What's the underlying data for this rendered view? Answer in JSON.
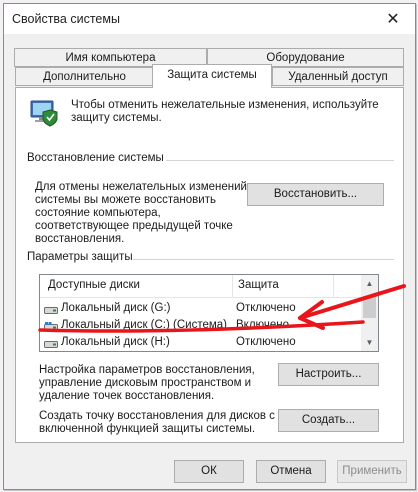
{
  "window": {
    "title": "Свойства системы",
    "close_glyph": "✕"
  },
  "tabs": {
    "row1": [
      "Имя компьютера",
      "Оборудование"
    ],
    "row2": [
      "Дополнительно",
      "Защита системы",
      "Удаленный доступ"
    ],
    "selected": "Защита системы"
  },
  "intro": {
    "icon": "computer-shield-icon",
    "text_line1": "Чтобы отменить нежелательные изменения, используйте",
    "text_line2": "защиту системы."
  },
  "restore": {
    "group_title": "Восстановление системы",
    "desc_line1": "Для отмены нежелательных изменений",
    "desc_line2": "системы вы можете восстановить",
    "desc_line3": "состояние компьютера,",
    "desc_line4": "соответствующее предыдущей точке",
    "desc_line5": "восстановления.",
    "button": "Восстановить..."
  },
  "protection": {
    "group_title": "Параметры защиты",
    "columns": [
      "Доступные диски",
      "Защита"
    ],
    "drives": [
      {
        "name": "Локальный диск (G:)",
        "protection": "Отключено",
        "icon": "drive-icon"
      },
      {
        "name": "Локальный диск (C:) (Система)",
        "protection": "Включено",
        "icon": "system-drive-icon"
      },
      {
        "name": "Локальный диск (H:)",
        "protection": "Отключено",
        "icon": "drive-icon"
      }
    ],
    "configure_line1": "Настройка параметров восстановления,",
    "configure_line2": "управление дисковым пространством и",
    "configure_line3": "удаление точек восстановления.",
    "configure_button": "Настроить...",
    "create_line1": "Создать точку восстановления для дисков с",
    "create_line2": "включенной функцией защиты системы.",
    "create_button": "Создать..."
  },
  "footer": {
    "ok": "ОК",
    "cancel": "Отмена",
    "apply": "Применить"
  },
  "annotation": {
    "color": "#e8161c"
  }
}
